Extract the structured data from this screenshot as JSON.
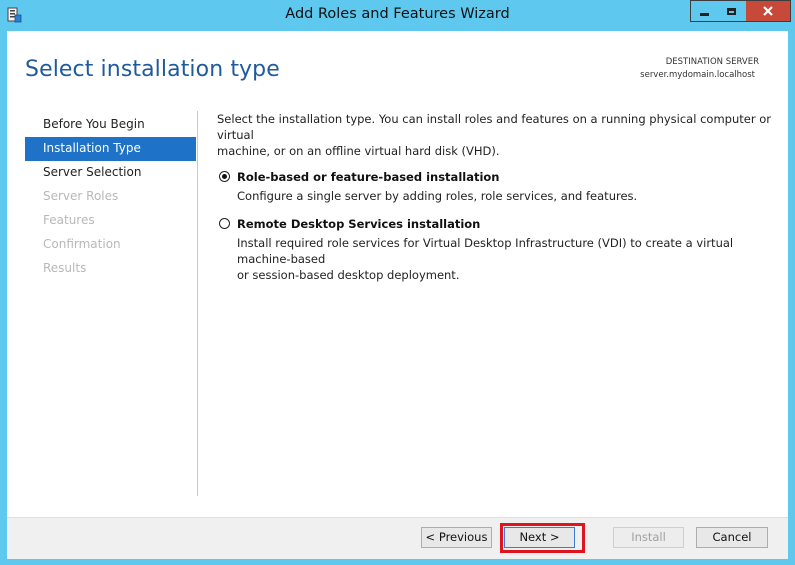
{
  "window": {
    "title": "Add Roles and Features Wizard",
    "icon": "server-manager-icon",
    "controls": [
      "minimize-icon",
      "maximize-icon",
      "close-icon"
    ]
  },
  "header": {
    "title": "Select installation type",
    "destination_label": "DESTINATION SERVER",
    "destination_value": "server.mydomain.localhost"
  },
  "nav": {
    "items": [
      {
        "label": "Before You Begin",
        "state": "enabled"
      },
      {
        "label": "Installation Type",
        "state": "active"
      },
      {
        "label": "Server Selection",
        "state": "enabled"
      },
      {
        "label": "Server Roles",
        "state": "disabled"
      },
      {
        "label": "Features",
        "state": "disabled"
      },
      {
        "label": "Confirmation",
        "state": "disabled"
      },
      {
        "label": "Results",
        "state": "disabled"
      }
    ]
  },
  "content": {
    "description_line1": "Select the installation type. You can install roles and features on a running physical computer or virtual",
    "description_line2": "machine, or on an offline virtual hard disk (VHD).",
    "options": [
      {
        "label": "Role-based or feature-based installation",
        "desc_line1": "Configure a single server by adding roles, role services, and features.",
        "desc_line2": "",
        "checked": true
      },
      {
        "label": "Remote Desktop Services installation",
        "desc_line1": "Install required role services for Virtual Desktop Infrastructure (VDI) to create a virtual machine-based",
        "desc_line2": "or session-based desktop deployment.",
        "checked": false
      }
    ]
  },
  "footer": {
    "previous_label": "< Previous",
    "next_label": "Next >",
    "install_label": "Install",
    "cancel_label": "Cancel"
  },
  "colors": {
    "title_bar": "#5ec8ee",
    "accent": "#1e72c7",
    "header_title": "#1e5a9c",
    "highlight": "#e0141e",
    "close_button": "#c7493a"
  }
}
